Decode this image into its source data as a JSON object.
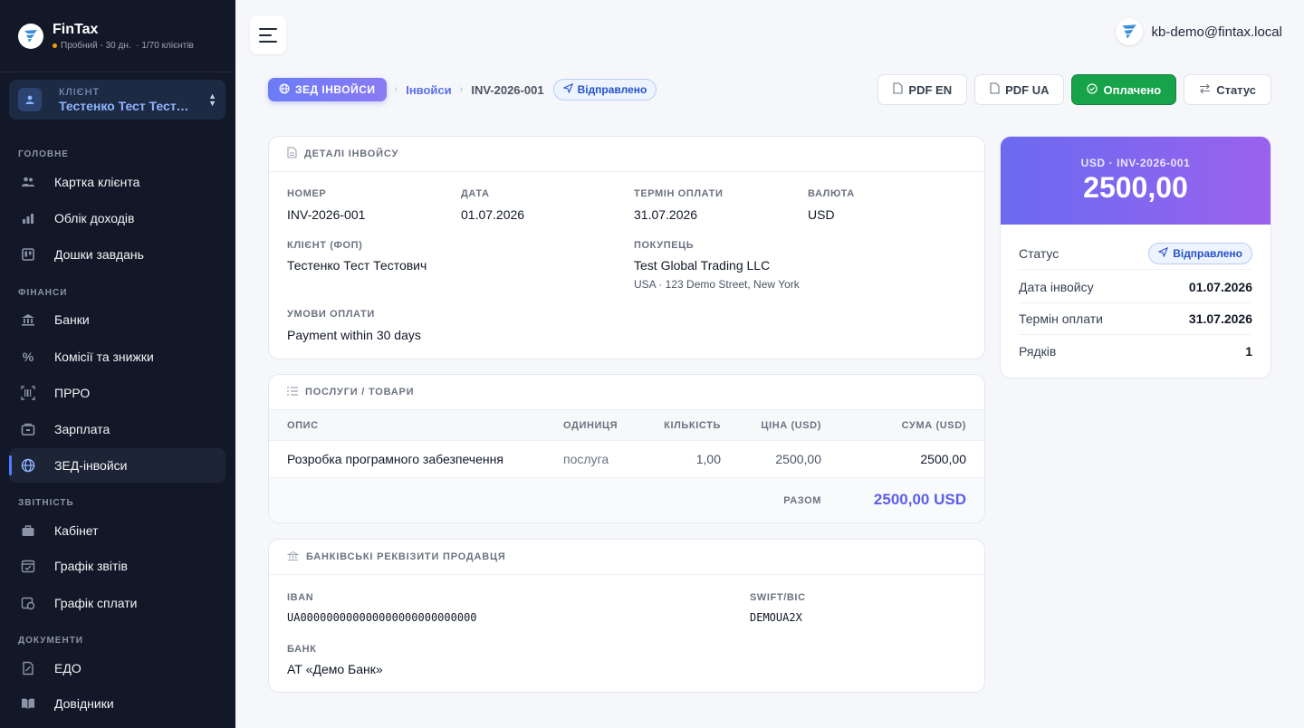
{
  "brand": {
    "name": "FinTax",
    "trial": "Пробний - 30 дн.",
    "clients": "· 1/70 клієнтів"
  },
  "client": {
    "label": "КЛІЄНТ",
    "name": "Тестенко Тест Тестович"
  },
  "sidebar": {
    "sections": [
      "ГОЛОВНЕ",
      "ФІНАНСИ",
      "ЗВІТНІСТЬ",
      "ДОКУМЕНТИ"
    ],
    "items": [
      {
        "label": "Картка клієнта",
        "icon": "users-icon"
      },
      {
        "label": "Облік доходів",
        "icon": "bar-chart-icon"
      },
      {
        "label": "Дошки завдань",
        "icon": "kanban-icon"
      },
      {
        "label": "Банки",
        "icon": "bank-icon"
      },
      {
        "label": "Комісії та знижки",
        "icon": "percent-icon"
      },
      {
        "label": "ПРРО",
        "icon": "barcode-icon"
      },
      {
        "label": "Зарплата",
        "icon": "wallet-icon"
      },
      {
        "label": "ЗЕД-інвойси",
        "icon": "globe-icon",
        "active": true
      },
      {
        "label": "Кабінет",
        "icon": "briefcase-icon"
      },
      {
        "label": "Графік звітів",
        "icon": "calendar-check-icon"
      },
      {
        "label": "Графік сплати",
        "icon": "calendar-money-icon"
      },
      {
        "label": "ЕДО",
        "icon": "document-sign-icon"
      },
      {
        "label": "Довідники",
        "icon": "book-icon"
      }
    ]
  },
  "header": {
    "user_email": "kb-demo@fintax.local"
  },
  "breadcrumb": {
    "module": "ЗЕД ІНВОЙСИ",
    "link": "Інвойси",
    "current": "INV-2026-001",
    "status": "Відправлено"
  },
  "actions": {
    "pdf_en": "PDF EN",
    "pdf_ua": "PDF UA",
    "paid": "Оплачено",
    "status": "Статус"
  },
  "details": {
    "title": "ДЕТАЛІ ІНВОЙСУ",
    "number_label": "НОМЕР",
    "number": "INV-2026-001",
    "date_label": "ДАТА",
    "date": "01.07.2026",
    "due_label": "ТЕРМІН ОПЛАТИ",
    "due": "31.07.2026",
    "currency_label": "ВАЛЮТА",
    "currency": "USD",
    "client_label": "КЛІЄНТ (ФОП)",
    "client": "Тестенко Тест Тестович",
    "buyer_label": "ПОКУПЕЦЬ",
    "buyer": "Test Global Trading LLC",
    "buyer_address": "USA · 123 Demo Street, New York",
    "terms_label": "УМОВИ ОПЛАТИ",
    "terms": "Payment within 30 days"
  },
  "services": {
    "title": "ПОСЛУГИ / ТОВАРИ",
    "columns": [
      "ОПИС",
      "ОДИНИЦЯ",
      "КІЛЬКІСТЬ",
      "ЦІНА (USD)",
      "СУМА (USD)"
    ],
    "rows": [
      {
        "description": "Розробка програмного забезпечення",
        "unit": "послуга",
        "qty": "1,00",
        "price": "2500,00",
        "sum": "2500,00"
      }
    ],
    "total_label": "РАЗОМ",
    "total": "2500,00 USD"
  },
  "bank": {
    "title": "БАНКІВСЬКІ РЕКВІЗИТИ ПРОДАВЦЯ",
    "iban_label": "IBAN",
    "iban": "UA000000000000000000000000000",
    "swift_label": "SWIFT/BIC",
    "swift": "DEMOUA2X",
    "bank_label": "БАНК",
    "bank_name": "АТ «Демо Банк»"
  },
  "summary": {
    "subtitle": "USD · INV-2026-001",
    "amount": "2500,00",
    "rows": [
      {
        "label": "Статус",
        "value": "Відправлено"
      },
      {
        "label": "Дата інвойсу",
        "value": "01.07.2026"
      },
      {
        "label": "Термін оплати",
        "value": "31.07.2026"
      },
      {
        "label": "Рядків",
        "value": "1"
      }
    ]
  },
  "colors": {
    "sidebar_bg": "#121828",
    "accent": "#5b6ee8",
    "paid_green": "#16a34a",
    "status_blue": "#2452c7"
  }
}
